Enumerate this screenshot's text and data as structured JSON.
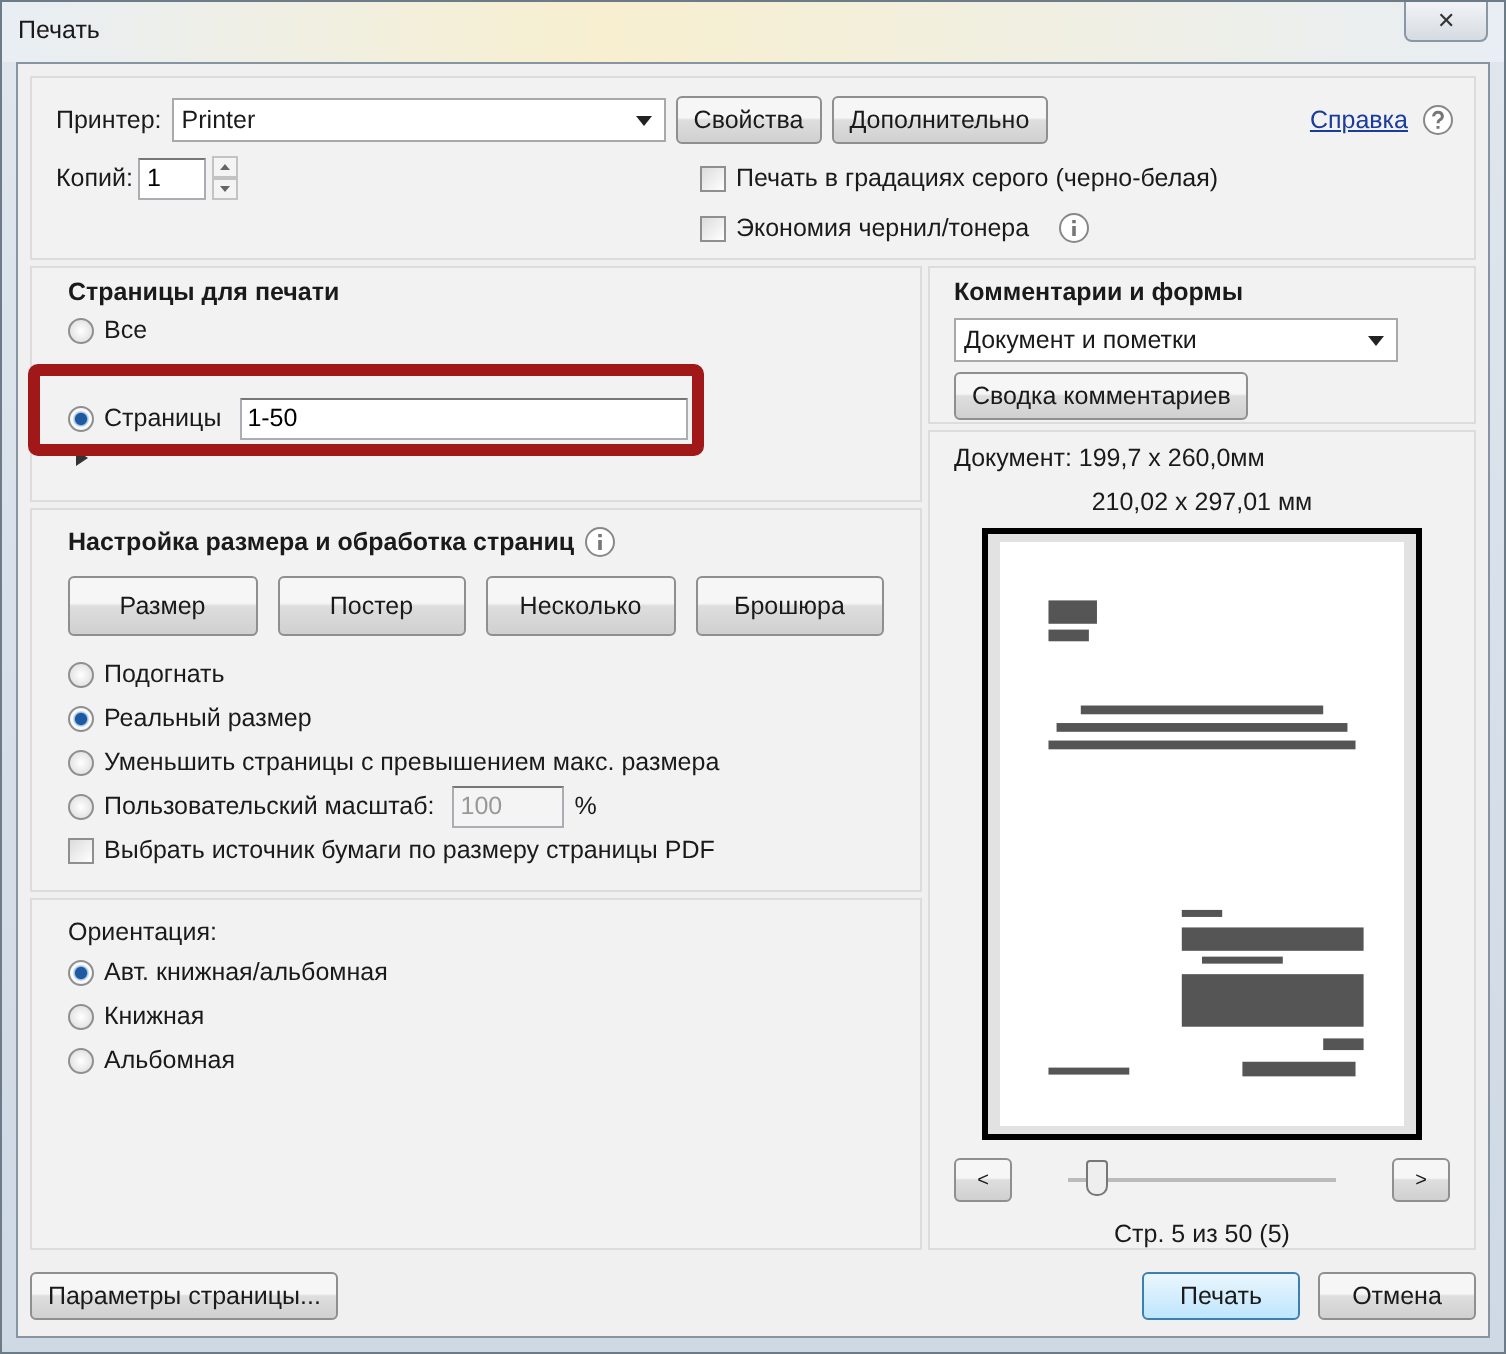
{
  "window": {
    "title": "Печать",
    "close": "✕"
  },
  "top": {
    "printer_label": "Принтер:",
    "printer": "Printer",
    "buttons": [
      "Свойства",
      "Дополнительно"
    ],
    "help_link": "Справка",
    "copies_label": "Копий:",
    "copies": "1",
    "options": [
      {
        "label": "Печать в градациях серого (черно-белая)",
        "checked": false,
        "info": false
      },
      {
        "label": "Экономия чернил/тонера",
        "checked": false,
        "info": true
      }
    ]
  },
  "pages": {
    "title": "Страницы для печати",
    "highlighted": true,
    "options": [
      {
        "label": "Все",
        "selected": false
      },
      {
        "label": "Страницы",
        "selected": true,
        "value": "1-50"
      }
    ]
  },
  "sizing": {
    "title": "Настройка размера и обработка страниц",
    "buttons": [
      "Размер",
      "Постер",
      "Несколько",
      "Брошюра"
    ],
    "options": [
      {
        "kind": "radio",
        "label": "Подогнать",
        "selected": false
      },
      {
        "kind": "radio",
        "label": "Реальный размер",
        "selected": true
      },
      {
        "kind": "radio",
        "label": "Уменьшить страницы с превышением макс. размера",
        "selected": false
      },
      {
        "kind": "scale",
        "label": "Пользовательский масштаб:",
        "selected": false,
        "value": "100",
        "unit": "%"
      }
    ],
    "paper_source": {
      "label": "Выбрать источник бумаги по размеру страницы PDF",
      "checked": false
    }
  },
  "orientation": {
    "title": "Ориентация:",
    "options": [
      {
        "label": "Авт. книжная/альбомная",
        "selected": true
      },
      {
        "label": "Книжная",
        "selected": false
      },
      {
        "label": "Альбомная",
        "selected": false
      }
    ]
  },
  "comments": {
    "title": "Комментарии и формы",
    "dropdown": "Документ и пометки",
    "button": "Сводка комментариев"
  },
  "preview": {
    "document_size": "Документ: 199,7 x 260,0мм",
    "paper_size": "210,02 x 297,01 мм",
    "prev": "<",
    "next": ">",
    "slider": {
      "level": 0.1
    },
    "page_info": "Стр. 5 из 50 (5)"
  },
  "footer": {
    "page_setup": "Параметры страницы...",
    "print": "Печать",
    "cancel": "Отмена"
  }
}
